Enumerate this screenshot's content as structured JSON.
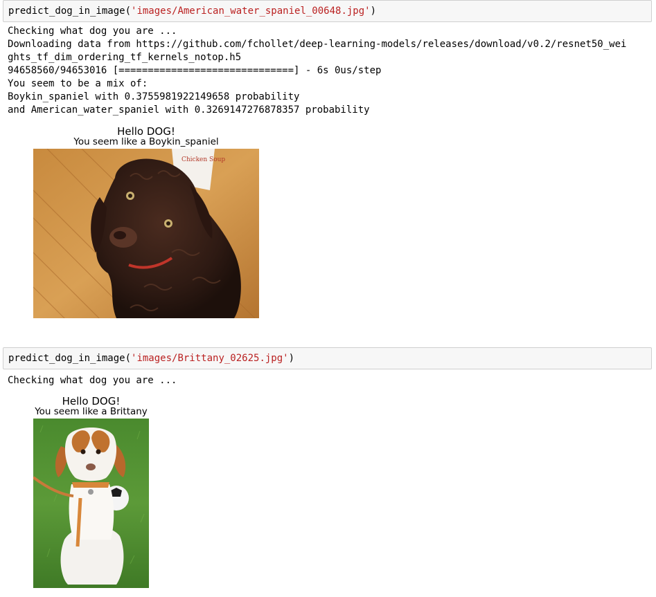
{
  "cells": [
    {
      "input": {
        "function": "predict_dog_in_image",
        "open_paren": "(",
        "argument": "'images/American_water_spaniel_00648.jpg'",
        "close_paren": ")"
      },
      "output_text": "Checking what dog you are ...\nDownloading data from https://github.com/fchollet/deep-learning-models/releases/download/v0.2/resnet50_wei\nghts_tf_dim_ordering_tf_kernels_notop.h5\n94658560/94653016 [==============================] - 6s 0us/step\nYou seem to be a mix of:\nBoykin_spaniel with 0.3755981922149658 probability\nand American_water_spaniel with 0.3269147276878357 probability",
      "figure": {
        "title_line1": "Hello DOG!",
        "title_line2": "You seem like a Boykin_spaniel",
        "image_subject": "brown curly-coated puppy on a wooden floor"
      }
    },
    {
      "input": {
        "function": "predict_dog_in_image",
        "open_paren": "(",
        "argument": "'images/Brittany_02625.jpg'",
        "close_paren": ")"
      },
      "output_text": "Checking what dog you are ...",
      "figure": {
        "title_line1": "Hello DOG!",
        "title_line2": "You seem like a Brittany",
        "image_subject": "white and orange puppy sitting on grass with a soccer ball"
      }
    }
  ],
  "colors": {
    "input_background": "#f7f7f7",
    "input_border": "#cfcfcf",
    "string_literal": "#ba2121"
  }
}
